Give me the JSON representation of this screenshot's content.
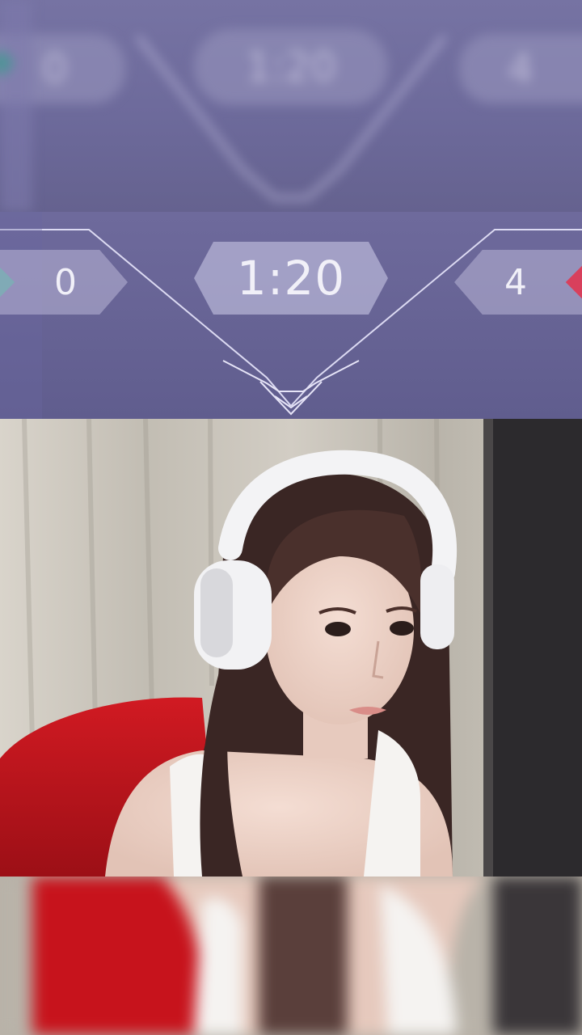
{
  "hud": {
    "timer": "1:20",
    "score_left": "0",
    "score_right": "4",
    "team_left_color": "#3a9c8e",
    "team_right_color": "#d8405c"
  },
  "top_blur": {
    "timer": "1:20",
    "score_left": "0",
    "score_right": "4"
  },
  "colors": {
    "hud_background": "#65628f",
    "hud_line": "#d6d4ee",
    "chair_red": "#c4161c",
    "headphones": "#f2f2f4",
    "top_white": "#f5f3f1"
  },
  "webcam": {
    "label": "streamer webcam"
  }
}
